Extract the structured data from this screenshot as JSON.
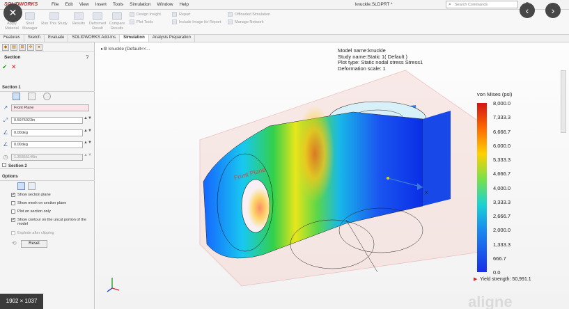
{
  "menubar": {
    "logo": "SOLIDWORKS",
    "items": [
      "File",
      "Edit",
      "View",
      "Insert",
      "Tools",
      "Simulation",
      "Window",
      "Help"
    ],
    "document_title": "knuckle.SLDPRT *",
    "search_placeholder": "Search Commands"
  },
  "ribbon": {
    "buttons": [
      {
        "label": "Apply\nMaterial"
      },
      {
        "label": "Shell\nManager"
      },
      {
        "label": "Run This Study"
      },
      {
        "label": "Results"
      },
      {
        "label": "Deformed\nResult"
      },
      {
        "label": "Compare\nResults"
      }
    ],
    "small": [
      "Design Insight",
      "Plot Tools",
      "Report",
      "Include Image for Report",
      "Offloaded Simulation",
      "Manage Network"
    ]
  },
  "tabs": [
    "Features",
    "Sketch",
    "Evaluate",
    "SOLIDWORKS Add-Ins",
    "Simulation",
    "Analysis Preparation"
  ],
  "active_tab": "Simulation",
  "panel": {
    "title": "Section",
    "section1_label": "Section 1",
    "plane": "Front Plane",
    "offset": "0.5975023in",
    "angle1": "0.00deg",
    "angle2": "0.00deg",
    "value3": "1.35855140in",
    "section2_label": "Section 2",
    "options_label": "Options",
    "checks": [
      {
        "label": "Show section plane",
        "checked": true
      },
      {
        "label": "Show mesh on section plane",
        "checked": false
      },
      {
        "label": "Plot on section only",
        "checked": false
      },
      {
        "label": "Show contour on the uncut portion of the model",
        "checked": true
      },
      {
        "label": "Explode after clipping",
        "checked": false
      }
    ],
    "reset_label": "Reset"
  },
  "viewport": {
    "tree_label": "knuckle (Default<<...",
    "info": [
      "Model name:knuckle",
      "Study name:Static 1( Default )",
      "Plot type: Static nodal stress Stress1",
      "Deformation scale: 1"
    ],
    "plane_label": "Front Plane",
    "yield": "Yield strength: 50,991.1"
  },
  "legend": {
    "title": "von Mises (psi)",
    "ticks": [
      "8,000.0",
      "7,333.3",
      "6,666.7",
      "6,000.0",
      "5,333.3",
      "4,666.7",
      "4,000.0",
      "3,333.3",
      "2,666.7",
      "2,000.0",
      "1,333.3",
      "666.7",
      "0.0"
    ]
  },
  "overlay": {
    "close": "✕",
    "prev": "‹",
    "next": "›",
    "dimensions": "1902 × 1037",
    "watermark": "aligne"
  }
}
